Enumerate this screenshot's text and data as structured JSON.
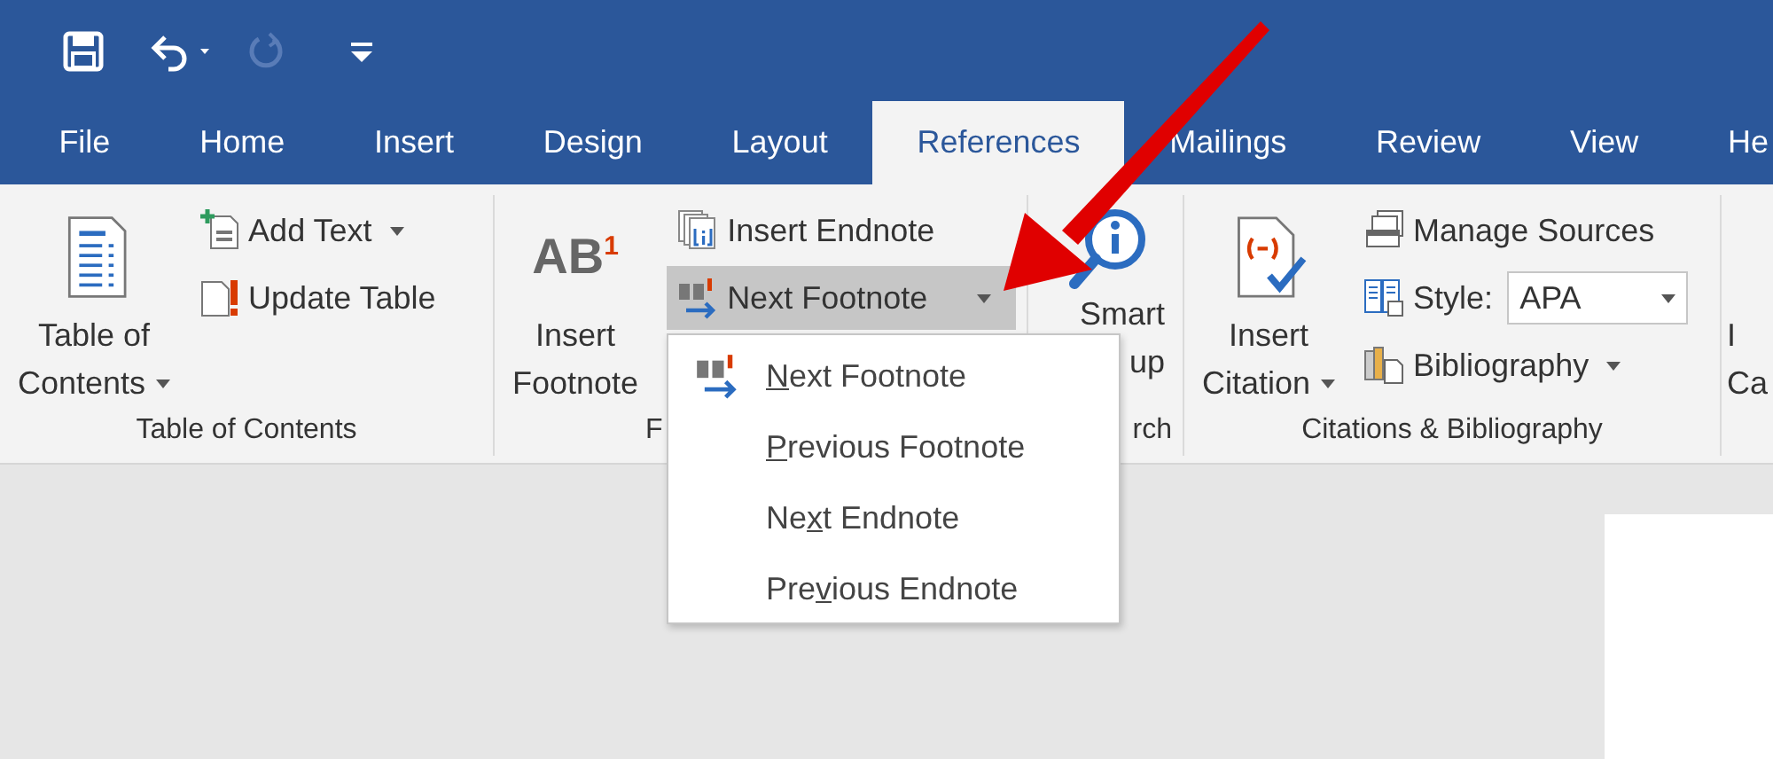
{
  "quick_access": [
    {
      "kind": "save",
      "disabled": false
    },
    {
      "kind": "undo",
      "disabled": false
    },
    {
      "kind": "undo-menu",
      "disabled": false
    },
    {
      "kind": "redo",
      "disabled": true
    },
    {
      "kind": "customize",
      "disabled": false
    }
  ],
  "tabs": [
    {
      "label": "File",
      "selected": false
    },
    {
      "label": "Home",
      "selected": false
    },
    {
      "label": "Insert",
      "selected": false
    },
    {
      "label": "Design",
      "selected": false
    },
    {
      "label": "Layout",
      "selected": false
    },
    {
      "label": "References",
      "selected": true
    },
    {
      "label": "Mailings",
      "selected": false
    },
    {
      "label": "Review",
      "selected": false
    },
    {
      "label": "View",
      "selected": false
    },
    {
      "label": "He",
      "selected": false
    }
  ],
  "ribbon_groups": [
    {
      "label": "Table of Contents",
      "controls": [
        {
          "kind": "large",
          "lines": [
            "Table of",
            "Contents"
          ],
          "dropdown": true
        },
        {
          "kind": "stack",
          "items": [
            {
              "kind": "button",
              "label": "Add Text",
              "dropdown": true,
              "pressed": false
            },
            {
              "kind": "button",
              "label": "Update Table",
              "dropdown": false,
              "pressed": false
            }
          ]
        }
      ]
    },
    {
      "label": "F",
      "controls": [
        {
          "kind": "large",
          "icon_text": "AB$^{1}$",
          "lines": [
            "Insert",
            "Footnote"
          ],
          "dropdown": false
        },
        {
          "kind": "stack",
          "items": [
            {
              "kind": "button",
              "label": "Insert Endnote",
              "dropdown": false,
              "pressed": false
            },
            {
              "kind": "button",
              "label": "Next Footnote",
              "dropdown": true,
              "pressed": true
            }
          ]
        }
      ]
    },
    {
      "label": "rch",
      "controls": [
        {
          "kind": "large",
          "lines": [
            "Smart",
            "up"
          ],
          "dropdown": false
        }
      ]
    },
    {
      "label": "Citations & Bibliography",
      "controls": [
        {
          "kind": "large",
          "lines": [
            "Insert",
            "Citation"
          ],
          "dropdown": true
        },
        {
          "kind": "stack",
          "items": [
            {
              "kind": "button",
              "label": "Manage Sources",
              "dropdown": false,
              "pressed": false
            },
            {
              "kind": "combo",
              "label": "Style:",
              "value": "APA"
            },
            {
              "kind": "button",
              "label": "Bibliography",
              "dropdown": true,
              "pressed": false
            }
          ]
        }
      ]
    },
    {
      "controls": [
        {
          "kind": "large",
          "lines": [
            "I",
            "Ca"
          ]
        }
      ]
    }
  ],
  "menu": {
    "items": [
      {
        "kind": "with-icon",
        "key": "N",
        "after": "ext Footnote"
      },
      {
        "kind": "plain",
        "key": "P",
        "after": "revious Footnote"
      },
      {
        "kind": "plain",
        "before": "Ne",
        "key": "x",
        "after": "t Endnote"
      },
      {
        "kind": "plain",
        "before": "Pre",
        "key": "v",
        "after": "ious Endnote"
      }
    ]
  }
}
